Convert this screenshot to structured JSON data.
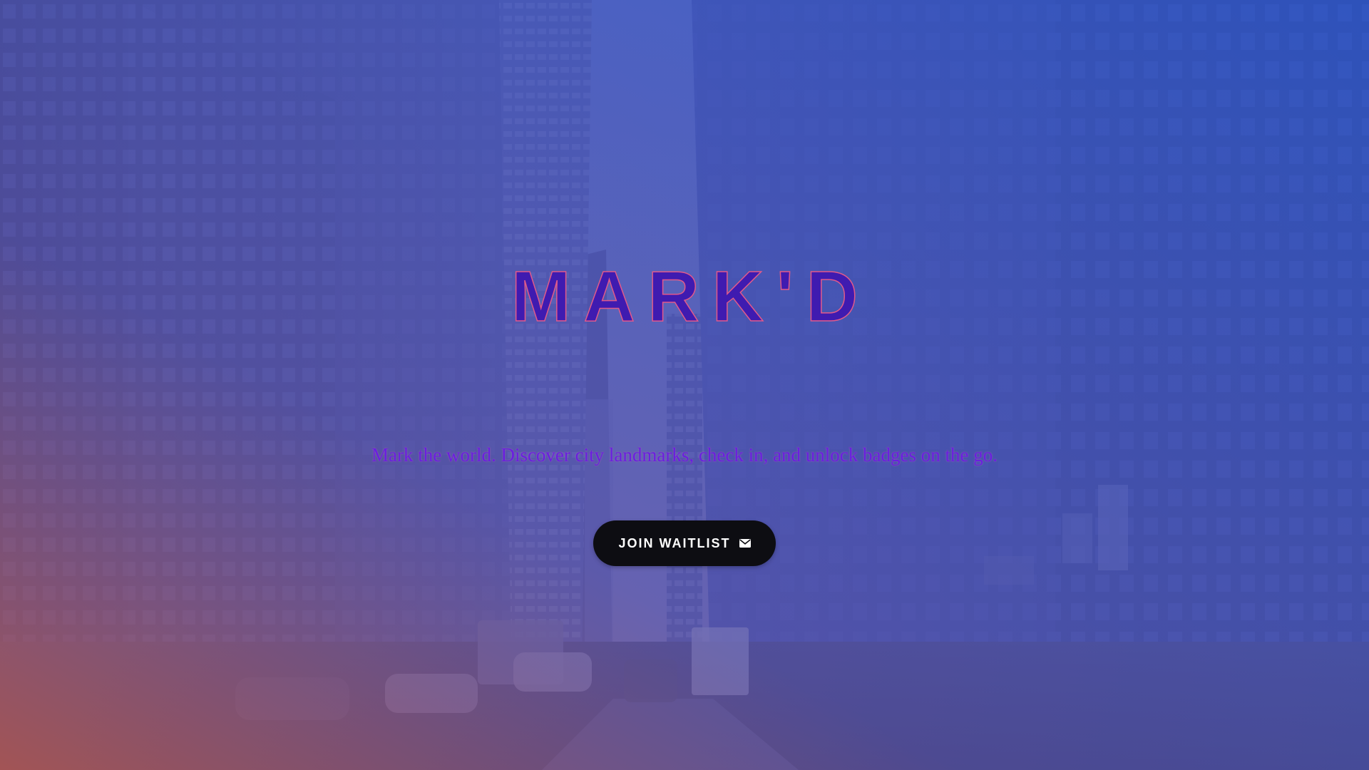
{
  "hero": {
    "title": "MARK'D",
    "tagline": "Mark the world. Discover city landmarks, check in, and unlock badges on the go.",
    "cta": {
      "label": "JOIN WAITLIST",
      "icon": "envelope-icon"
    }
  },
  "colors": {
    "overlay_top_left": "#4a5bc8",
    "overlay_bottom_left": "#a35a6e",
    "overlay_right": "#3457c0",
    "title_fill": "#3f1bb0",
    "title_stroke": "#e05a8a",
    "tagline": "#6a1fe0",
    "button_bg": "#0d0d12",
    "button_text": "#ffffff"
  }
}
